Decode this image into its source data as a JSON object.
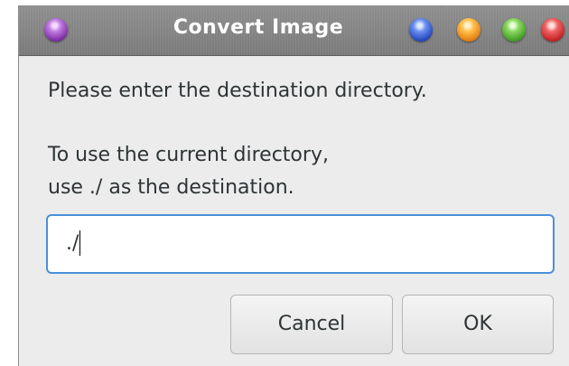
{
  "window": {
    "title": "Convert Image"
  },
  "titlebar": {
    "menu_orb_icon": "purple-orb-icon",
    "buttons": [
      {
        "icon": "blue-orb-icon",
        "color": "#2343b8"
      },
      {
        "icon": "orange-orb-icon",
        "color": "#e07a10"
      },
      {
        "icon": "green-orb-icon",
        "color": "#3f9a22"
      },
      {
        "icon": "red-orb-icon",
        "color": "#c01e1e"
      }
    ]
  },
  "dialog": {
    "message_line1": "Please enter the destination directory.",
    "message_line2": "To use the current directory,",
    "message_line3": "use ./ as the destination.",
    "input_value": "./",
    "cancel_label": "Cancel",
    "ok_label": "OK"
  },
  "colors": {
    "focus_border": "#4a90d9",
    "window_bg": "#ececec",
    "text": "#2e3436"
  }
}
